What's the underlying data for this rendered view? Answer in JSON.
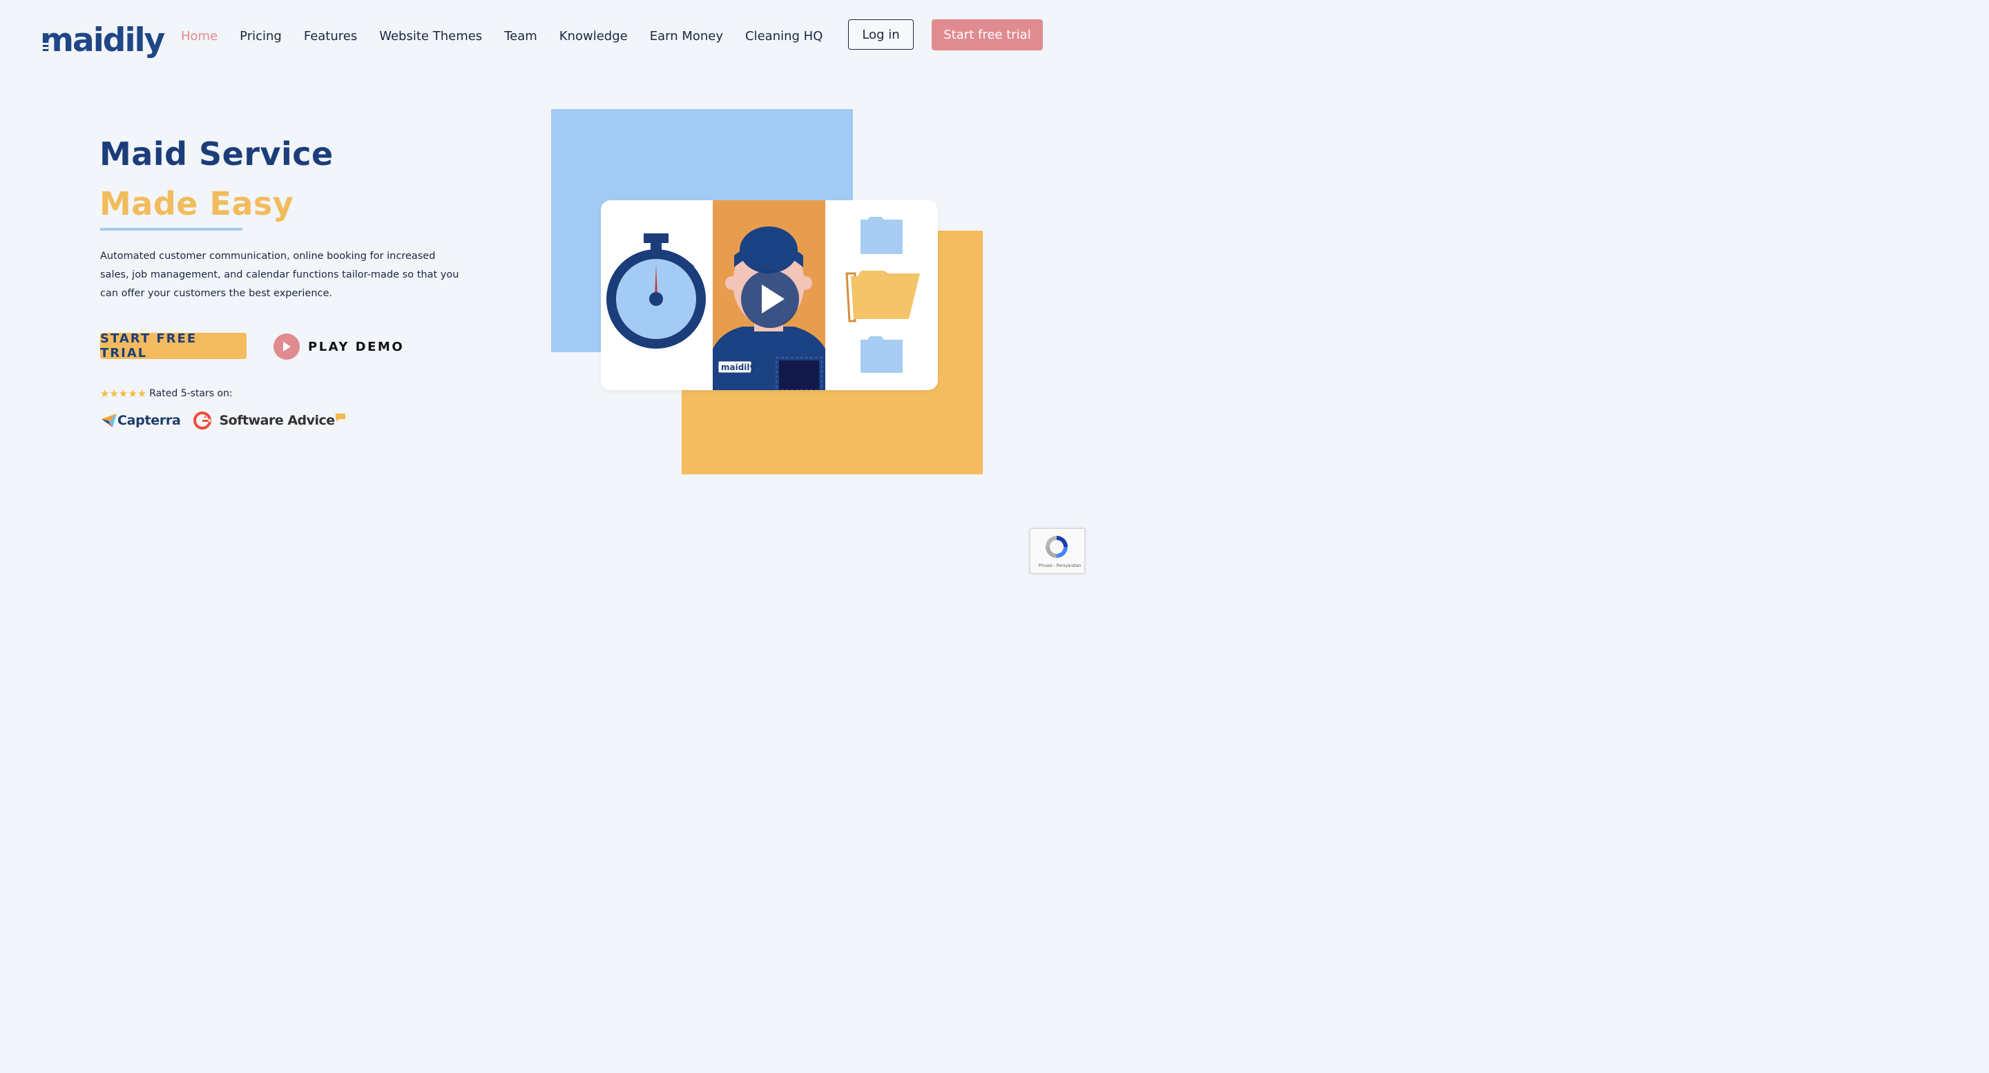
{
  "brand": {
    "logo_text": "maidily"
  },
  "nav": {
    "items": [
      {
        "label": "Home",
        "active": true
      },
      {
        "label": "Pricing"
      },
      {
        "label": "Features"
      },
      {
        "label": "Website Themes"
      },
      {
        "label": "Team"
      },
      {
        "label": "Knowledge"
      },
      {
        "label": "Earn Money"
      },
      {
        "label": "Cleaning HQ"
      }
    ],
    "login_label": "Log in",
    "trial_label": "Start free trial"
  },
  "hero": {
    "title_line1": "Maid Service",
    "title_line2": "Made Easy",
    "description": "Automated customer communication, online booking for increased sales, job management, and calendar functions tailor-made so that you can offer your customers the best experience.",
    "cta_trial": "START FREE TRIAL",
    "cta_demo": "PLAY DEMO",
    "rating_stars": "★★★★★",
    "rating_text": "Rated 5-stars on:",
    "review_sites": [
      "Capterra",
      "Software Advice"
    ]
  },
  "video": {
    "badge_text": "maidily"
  },
  "recaptcha": {
    "text": "Privasi - Persyaratan"
  },
  "colors": {
    "primary_blue": "#1b3d7a",
    "accent_pink": "#e08b90",
    "accent_yellow": "#f3bb5e",
    "light_blue": "#a2cbf3",
    "background": "#f2f5f9"
  }
}
